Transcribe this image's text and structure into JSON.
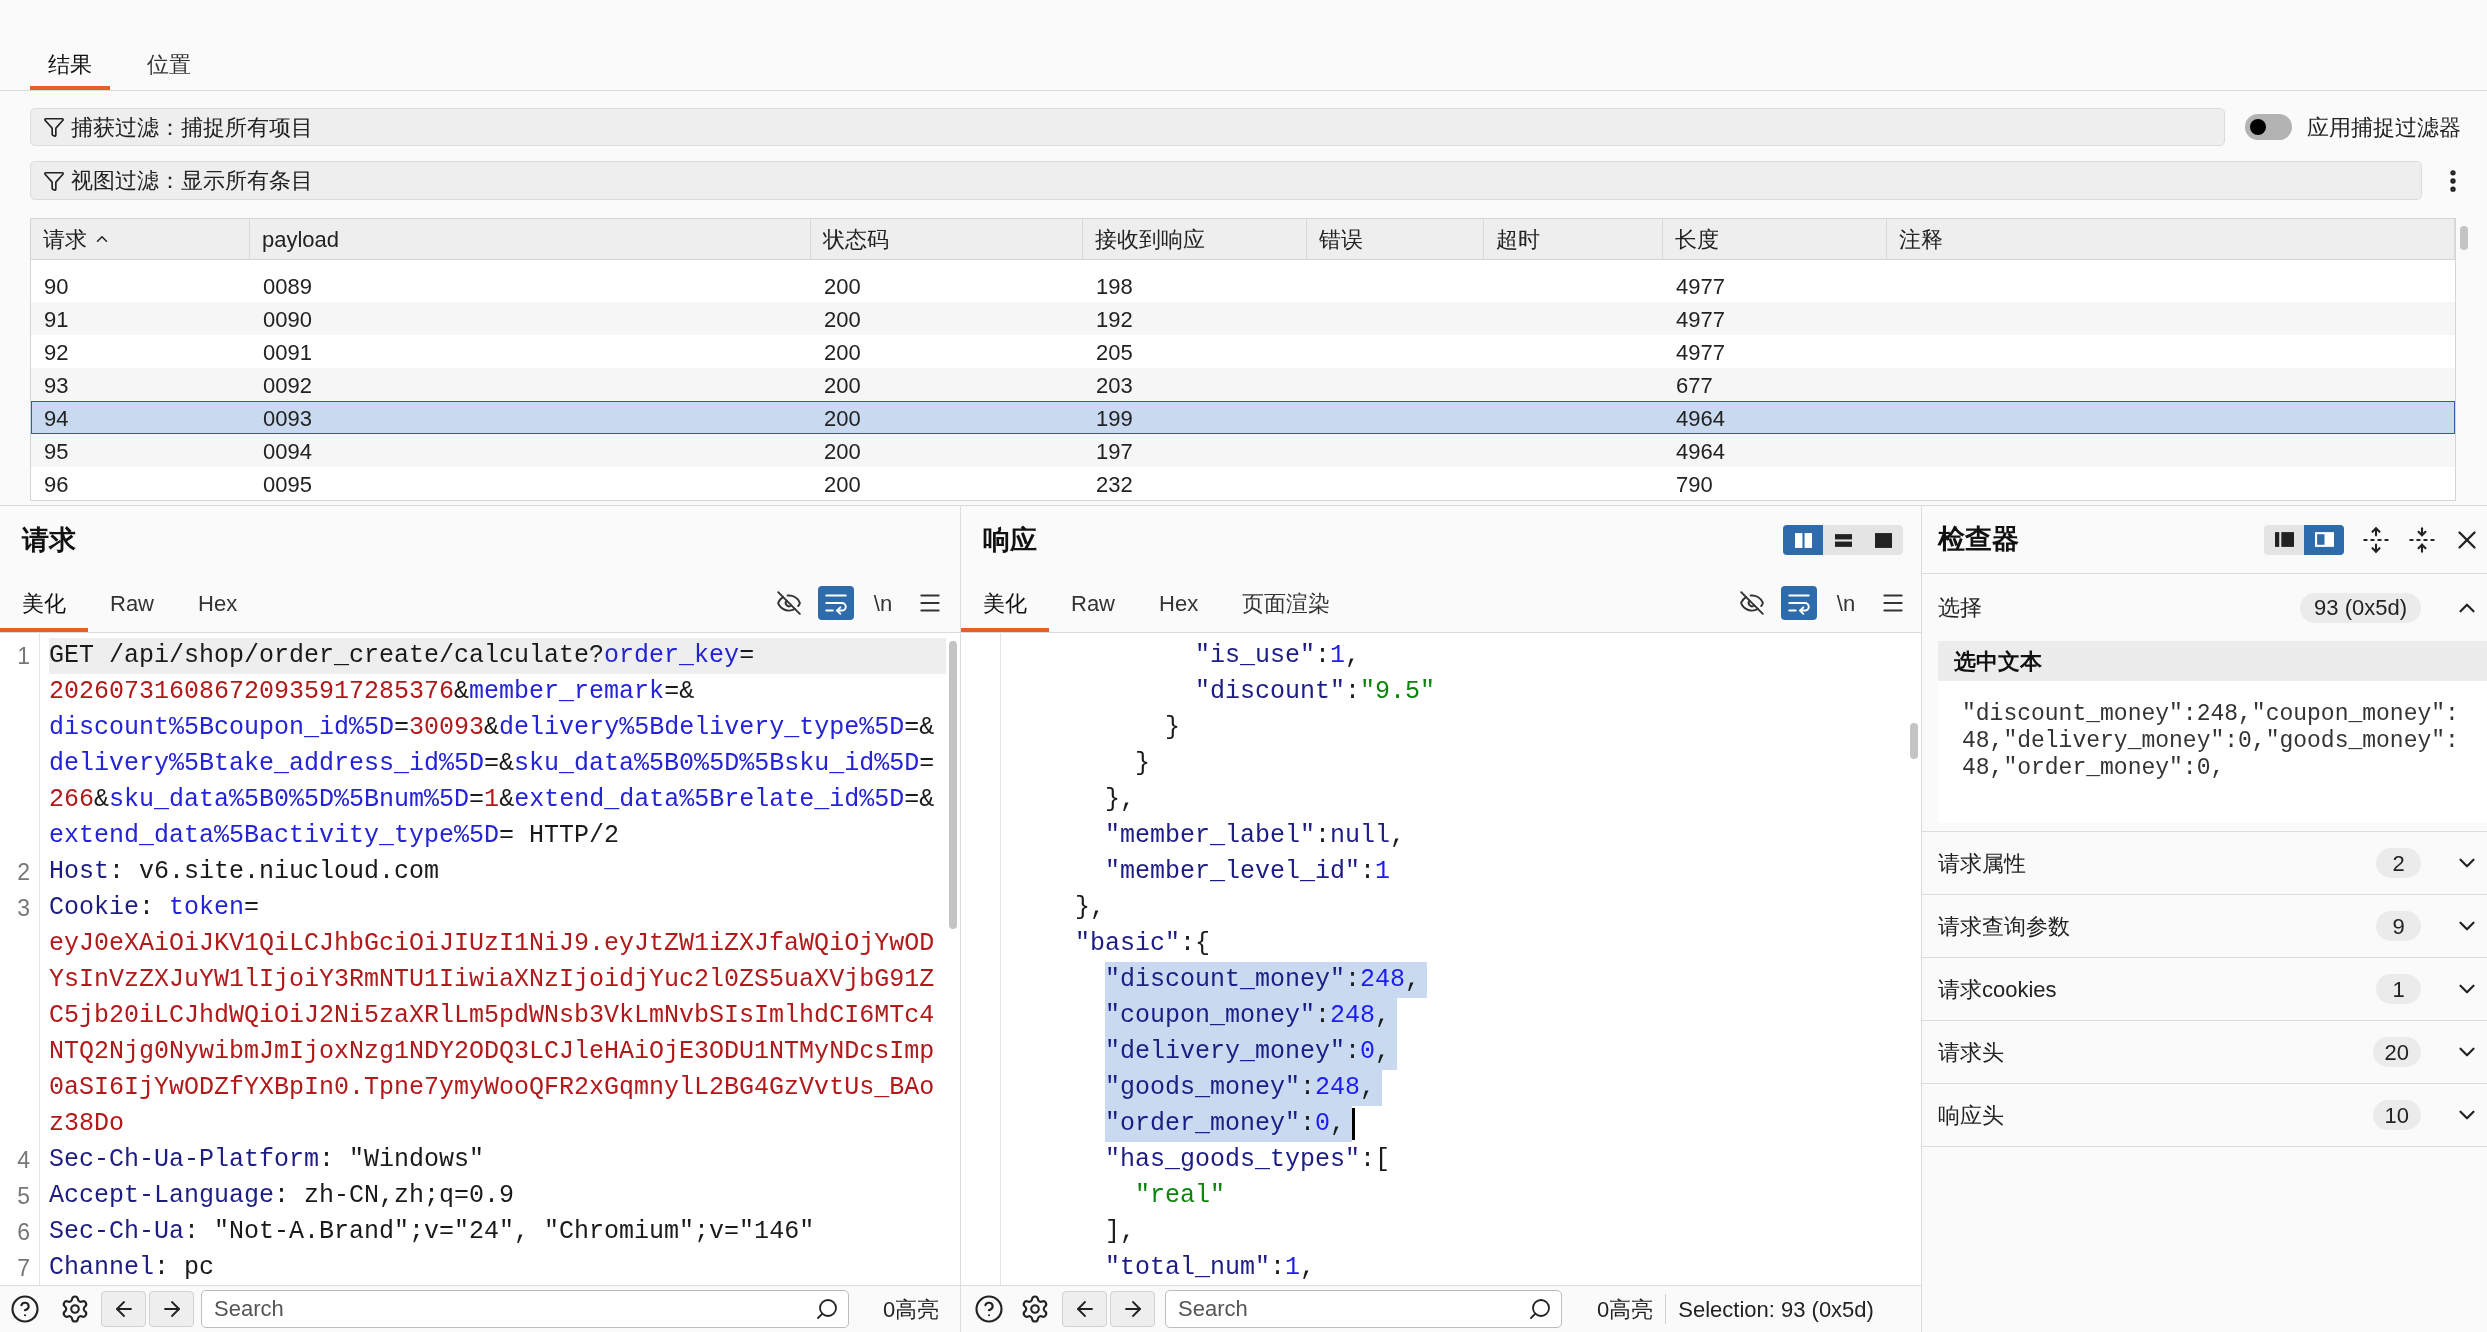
{
  "tabs": [
    {
      "label": "结果",
      "selected": true
    },
    {
      "label": "位置",
      "selected": false
    }
  ],
  "capture_filter": {
    "label": "捕获过滤：捕捉所有项目",
    "apply_toggle": {
      "label": "应用捕捉过滤器",
      "on": false
    }
  },
  "view_filter": {
    "label": "视图过滤：显示所有条目"
  },
  "table": {
    "columns": [
      {
        "label": "请求",
        "sorted": true
      },
      {
        "label": "payload",
        "sorted": false
      },
      {
        "label": "状态码",
        "sorted": false
      },
      {
        "label": "接收到响应",
        "sorted": false
      },
      {
        "label": "错误",
        "sorted": false
      },
      {
        "label": "超时",
        "sorted": false
      },
      {
        "label": "长度",
        "sorted": false
      },
      {
        "label": "注释",
        "sorted": false
      }
    ],
    "rows": [
      {
        "request": "90",
        "payload": "0089",
        "status": "200",
        "received": "198",
        "length": "4977",
        "selected": false
      },
      {
        "request": "91",
        "payload": "0090",
        "status": "200",
        "received": "192",
        "length": "4977",
        "selected": false
      },
      {
        "request": "92",
        "payload": "0091",
        "status": "200",
        "received": "205",
        "length": "4977",
        "selected": false
      },
      {
        "request": "93",
        "payload": "0092",
        "status": "200",
        "received": "203",
        "length": "677",
        "selected": false
      },
      {
        "request": "94",
        "payload": "0093",
        "status": "200",
        "received": "199",
        "length": "4964",
        "selected": true
      },
      {
        "request": "95",
        "payload": "0094",
        "status": "200",
        "received": "197",
        "length": "4964",
        "selected": false
      },
      {
        "request": "96",
        "payload": "0095",
        "status": "200",
        "received": "232",
        "length": "790",
        "selected": false
      }
    ]
  },
  "request": {
    "title": "请求",
    "tabs": [
      {
        "label": "美化",
        "selected": true
      },
      {
        "label": "Raw",
        "selected": false
      },
      {
        "label": "Hex",
        "selected": false
      }
    ],
    "tools": [
      {
        "kind": "hide",
        "selected": false
      },
      {
        "kind": "wrap",
        "selected": true
      },
      {
        "kind": "newline",
        "label": "\\n",
        "selected": false
      },
      {
        "kind": "menu",
        "selected": false
      }
    ],
    "lines": [
      {
        "number": "1",
        "active": true,
        "wrapped": [
          {
            "segments": [
              {
                "kind": "text",
                "text": "GET /api/shop/order_create/calculate?"
              },
              {
                "kind": "param",
                "text": "order_key"
              },
              {
                "kind": "text",
                "text": "="
              }
            ]
          },
          {
            "segments": [
              {
                "kind": "value",
                "text": "202607316086720935917285376"
              },
              {
                "kind": "text",
                "text": "&"
              },
              {
                "kind": "param",
                "text": "member_remark"
              },
              {
                "kind": "text",
                "text": "=&"
              }
            ]
          },
          {
            "segments": [
              {
                "kind": "param",
                "text": "discount%5Bcoupon_id%5D"
              },
              {
                "kind": "text",
                "text": "="
              },
              {
                "kind": "value",
                "text": "30093"
              },
              {
                "kind": "text",
                "text": "&"
              },
              {
                "kind": "param",
                "text": "delivery%5Bdelivery_type%5D"
              },
              {
                "kind": "text",
                "text": "=&"
              }
            ]
          },
          {
            "segments": [
              {
                "kind": "param",
                "text": "delivery%5Btake_address_id%5D"
              },
              {
                "kind": "text",
                "text": "=&"
              },
              {
                "kind": "param",
                "text": "sku_data%5B0%5D%5Bsku_id%5D"
              },
              {
                "kind": "text",
                "text": "="
              }
            ]
          },
          {
            "segments": [
              {
                "kind": "value",
                "text": "266"
              },
              {
                "kind": "text",
                "text": "&"
              },
              {
                "kind": "param",
                "text": "sku_data%5B0%5D%5Bnum%5D"
              },
              {
                "kind": "text",
                "text": "="
              },
              {
                "kind": "value",
                "text": "1"
              },
              {
                "kind": "text",
                "text": "&"
              },
              {
                "kind": "param",
                "text": "extend_data%5Brelate_id%5D"
              },
              {
                "kind": "text",
                "text": "=&"
              }
            ]
          },
          {
            "segments": [
              {
                "kind": "param",
                "text": "extend_data%5Bactivity_type%5D"
              },
              {
                "kind": "text",
                "text": "= HTTP/2"
              }
            ]
          }
        ]
      },
      {
        "number": "2",
        "active": false,
        "wrapped": [
          {
            "segments": [
              {
                "kind": "header",
                "text": "Host"
              },
              {
                "kind": "text",
                "text": ": v6.site.niucloud.com"
              }
            ]
          }
        ]
      },
      {
        "number": "3",
        "active": false,
        "wrapped": [
          {
            "segments": [
              {
                "kind": "header",
                "text": "Cookie"
              },
              {
                "kind": "text",
                "text": ": "
              },
              {
                "kind": "param",
                "text": "token"
              },
              {
                "kind": "text",
                "text": "="
              }
            ]
          },
          {
            "segments": [
              {
                "kind": "value",
                "text": "eyJ0eXAiOiJKV1QiLCJhbGciOiJIUzI1NiJ9.eyJtZW1iZXJfaWQiOjYwOD"
              }
            ]
          },
          {
            "segments": [
              {
                "kind": "value",
                "text": "YsInVzZXJuYW1lIjoiY3RmNTU1IiwiaXNzIjoidjYuc2l0ZS5uaXVjbG91Z"
              }
            ]
          },
          {
            "segments": [
              {
                "kind": "value",
                "text": "C5jb20iLCJhdWQiOiJ2Ni5zaXRlLm5pdWNsb3VkLmNvbSIsImlhdCI6MTc4"
              }
            ]
          },
          {
            "segments": [
              {
                "kind": "value",
                "text": "NTQ2Njg0NywibmJmIjoxNzg1NDY2ODQ3LCJleHAiOjE3ODU1NTMyNDcsImp"
              }
            ]
          },
          {
            "segments": [
              {
                "kind": "value",
                "text": "0aSI6IjYwODZfYXBpIn0.Tpne7ymyWooQFR2xGqmnylL2BG4GzVvtUs_BAo"
              }
            ]
          },
          {
            "segments": [
              {
                "kind": "value",
                "text": "z38Do"
              }
            ]
          }
        ]
      },
      {
        "number": "4",
        "active": false,
        "wrapped": [
          {
            "segments": [
              {
                "kind": "header",
                "text": "Sec-Ch-Ua-Platform"
              },
              {
                "kind": "text",
                "text": ": \"Windows\""
              }
            ]
          }
        ]
      },
      {
        "number": "5",
        "active": false,
        "wrapped": [
          {
            "segments": [
              {
                "kind": "header",
                "text": "Accept-Language"
              },
              {
                "kind": "text",
                "text": ": zh-CN,zh;q=0.9"
              }
            ]
          }
        ]
      },
      {
        "number": "6",
        "active": false,
        "wrapped": [
          {
            "segments": [
              {
                "kind": "header",
                "text": "Sec-Ch-Ua"
              },
              {
                "kind": "text",
                "text": ": \"Not-A.Brand\";v=\"24\", \"Chromium\";v=\"146\""
              }
            ]
          }
        ]
      },
      {
        "number": "7",
        "active": false,
        "wrapped": [
          {
            "segments": [
              {
                "kind": "header",
                "text": "Channel"
              },
              {
                "kind": "text",
                "text": ": pc"
              }
            ]
          }
        ]
      }
    ],
    "footer": {
      "search_placeholder": "Search",
      "highlights": "0高亮"
    }
  },
  "response": {
    "title": "响应",
    "layouts": [
      {
        "kind": "columns",
        "selected": true
      },
      {
        "kind": "rows",
        "selected": false
      },
      {
        "kind": "single",
        "selected": false
      }
    ],
    "tabs": [
      {
        "label": "美化",
        "selected": true
      },
      {
        "label": "Raw",
        "selected": false
      },
      {
        "label": "Hex",
        "selected": false
      },
      {
        "label": "页面渲染",
        "selected": false
      }
    ],
    "tools": [
      {
        "kind": "hide",
        "selected": false
      },
      {
        "kind": "wrap",
        "selected": true
      },
      {
        "kind": "newline",
        "label": "\\n",
        "selected": false
      },
      {
        "kind": "menu",
        "selected": false
      }
    ],
    "lines": [
      {
        "selected": false,
        "cursor": false,
        "segments": [
          {
            "kind": "key",
            "text": "            \"is_use\""
          },
          {
            "kind": "punct",
            "text": ":"
          },
          {
            "kind": "number",
            "text": "1"
          },
          {
            "kind": "punct",
            "text": ","
          }
        ]
      },
      {
        "selected": false,
        "cursor": false,
        "segments": [
          {
            "kind": "key",
            "text": "            \"discount\""
          },
          {
            "kind": "punct",
            "text": ":"
          },
          {
            "kind": "string",
            "text": "\"9.5\""
          }
        ]
      },
      {
        "selected": false,
        "cursor": false,
        "segments": [
          {
            "kind": "punct",
            "text": "          }"
          }
        ]
      },
      {
        "selected": false,
        "cursor": false,
        "segments": [
          {
            "kind": "punct",
            "text": "        }"
          }
        ]
      },
      {
        "selected": false,
        "cursor": false,
        "segments": [
          {
            "kind": "punct",
            "text": "      },"
          }
        ]
      },
      {
        "selected": false,
        "cursor": false,
        "segments": [
          {
            "kind": "key",
            "text": "      \"member_label\""
          },
          {
            "kind": "punct",
            "text": ":"
          },
          {
            "kind": "null",
            "text": "null"
          },
          {
            "kind": "punct",
            "text": ","
          }
        ]
      },
      {
        "selected": false,
        "cursor": false,
        "segments": [
          {
            "kind": "key",
            "text": "      \"member_level_id\""
          },
          {
            "kind": "punct",
            "text": ":"
          },
          {
            "kind": "number",
            "text": "1"
          }
        ]
      },
      {
        "selected": false,
        "cursor": false,
        "segments": [
          {
            "kind": "punct",
            "text": "    },"
          }
        ]
      },
      {
        "selected": false,
        "cursor": false,
        "segments": [
          {
            "kind": "key",
            "text": "    \"basic\""
          },
          {
            "kind": "punct",
            "text": ":{"
          }
        ]
      },
      {
        "selected": true,
        "cursor": false,
        "segments": [
          {
            "kind": "key",
            "text": "      \"discount_money\""
          },
          {
            "kind": "punct",
            "text": ":"
          },
          {
            "kind": "number",
            "text": "248"
          },
          {
            "kind": "punct",
            "text": ","
          }
        ]
      },
      {
        "selected": true,
        "cursor": false,
        "segments": [
          {
            "kind": "key",
            "text": "      \"coupon_money\""
          },
          {
            "kind": "punct",
            "text": ":"
          },
          {
            "kind": "number",
            "text": "248"
          },
          {
            "kind": "punct",
            "text": ","
          }
        ]
      },
      {
        "selected": true,
        "cursor": false,
        "segments": [
          {
            "kind": "key",
            "text": "      \"delivery_money\""
          },
          {
            "kind": "punct",
            "text": ":"
          },
          {
            "kind": "number",
            "text": "0"
          },
          {
            "kind": "punct",
            "text": ","
          }
        ]
      },
      {
        "selected": true,
        "cursor": false,
        "segments": [
          {
            "kind": "key",
            "text": "      \"goods_money\""
          },
          {
            "kind": "punct",
            "text": ":"
          },
          {
            "kind": "number",
            "text": "248"
          },
          {
            "kind": "punct",
            "text": ","
          }
        ]
      },
      {
        "selected": true,
        "cursor": true,
        "segments": [
          {
            "kind": "key",
            "text": "      \"order_money\""
          },
          {
            "kind": "punct",
            "text": ":"
          },
          {
            "kind": "number",
            "text": "0"
          },
          {
            "kind": "punct",
            "text": ","
          }
        ]
      },
      {
        "selected": false,
        "cursor": false,
        "segments": [
          {
            "kind": "key",
            "text": "      \"has_goods_types\""
          },
          {
            "kind": "punct",
            "text": ":["
          }
        ]
      },
      {
        "selected": false,
        "cursor": false,
        "segments": [
          {
            "kind": "string",
            "text": "        \"real\""
          }
        ]
      },
      {
        "selected": false,
        "cursor": false,
        "segments": [
          {
            "kind": "punct",
            "text": "      ],"
          }
        ]
      },
      {
        "selected": false,
        "cursor": false,
        "segments": [
          {
            "kind": "key",
            "text": "      \"total_num\""
          },
          {
            "kind": "punct",
            "text": ":"
          },
          {
            "kind": "number",
            "text": "1"
          },
          {
            "kind": "punct",
            "text": ","
          }
        ]
      }
    ],
    "footer": {
      "search_placeholder": "Search",
      "highlights": "0高亮",
      "selection": "Selection: 93 (0x5d)"
    }
  },
  "inspector": {
    "title": "检查器",
    "layouts": [
      {
        "kind": "dock-left",
        "selected": false
      },
      {
        "kind": "dock-right",
        "selected": true
      }
    ],
    "selection": {
      "label": "选择",
      "badge": "93 (0x5d)",
      "expanded": true,
      "text_title": "选中文本",
      "text_lines": [
        "\"discount_money\":248,\"coupon_money\":",
        "48,\"delivery_money\":0,\"goods_money\":",
        "48,\"order_money\":0,"
      ]
    },
    "sections": [
      {
        "label": "请求属性",
        "count": "2",
        "expanded": false
      },
      {
        "label": "请求查询参数",
        "count": "9",
        "expanded": false
      },
      {
        "label": "请求cookies",
        "count": "1",
        "expanded": false
      },
      {
        "label": "请求头",
        "count": "20",
        "expanded": false
      },
      {
        "label": "响应头",
        "count": "10",
        "expanded": false
      }
    ]
  }
}
